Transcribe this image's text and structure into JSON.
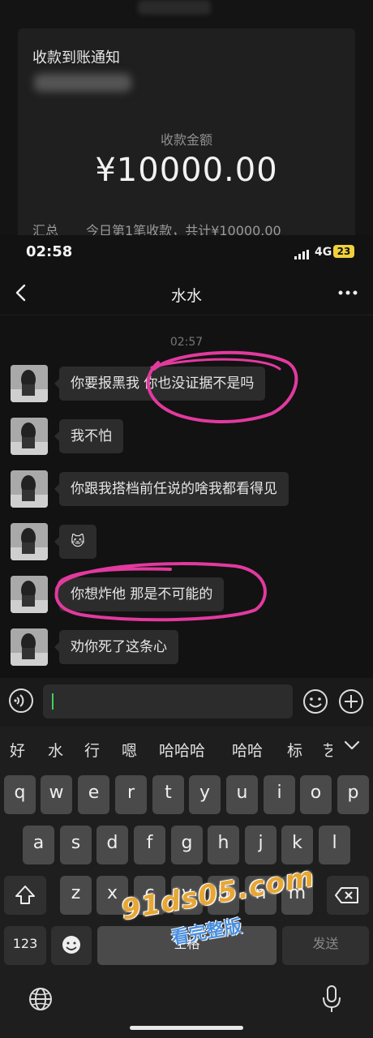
{
  "notification": {
    "title": "收款到账通知",
    "amount_label": "收款金额",
    "amount": "¥10000.00",
    "summary_label": "汇总",
    "summary_text": "今日第1笔收款，共计¥10000.00"
  },
  "status_bar": {
    "time": "02:58",
    "network": "4G",
    "battery": "23"
  },
  "chat": {
    "title": "水水",
    "timestamp": "02:57",
    "messages": [
      {
        "text": "你要报黑我 你也没证据不是吗"
      },
      {
        "text": "我不怕"
      },
      {
        "text": "你跟我搭档前任说的啥我都看得见"
      },
      {
        "text": "🐱"
      },
      {
        "text": "你想炸他 那是不可能的"
      },
      {
        "text": "劝你死了这条心"
      }
    ]
  },
  "input": {
    "value": ""
  },
  "keyboard": {
    "suggestions": [
      "好",
      "水",
      "行",
      "嗯",
      "哈哈哈",
      "哈哈",
      "标",
      "艺"
    ],
    "row1": [
      "q",
      "w",
      "e",
      "r",
      "t",
      "y",
      "u",
      "i",
      "o",
      "p"
    ],
    "row2": [
      "a",
      "s",
      "d",
      "f",
      "g",
      "h",
      "j",
      "k",
      "l"
    ],
    "row3": [
      "z",
      "x",
      "c",
      "v",
      "b",
      "n",
      "m"
    ],
    "num_label": "123",
    "space_label": "空格",
    "send_label": "发送"
  },
  "watermark": {
    "main": "91ds05.com",
    "sub": "看完整版"
  },
  "colors": {
    "highlight": "#e23a9e",
    "caret": "#3ecf5e",
    "battery": "#f2d03b"
  }
}
